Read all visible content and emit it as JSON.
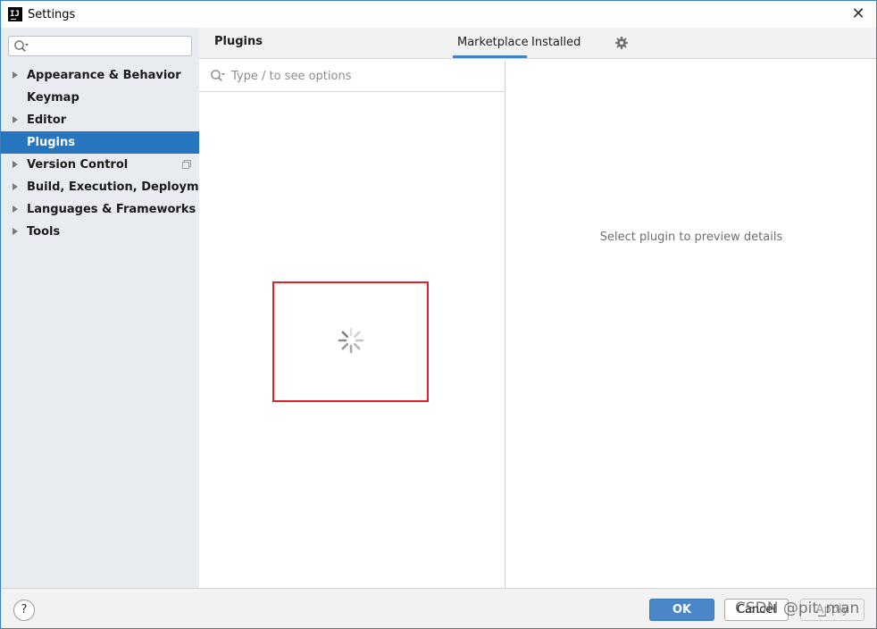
{
  "window": {
    "title": "Settings",
    "close_glyph": "✕",
    "app_icon_text": "IJ"
  },
  "sidebar": {
    "search": {
      "value": "",
      "placeholder": ""
    },
    "items": [
      {
        "label": "Appearance & Behavior",
        "expandable": true,
        "selected": false
      },
      {
        "label": "Keymap",
        "expandable": false,
        "selected": false
      },
      {
        "label": "Editor",
        "expandable": true,
        "selected": false
      },
      {
        "label": "Plugins",
        "expandable": false,
        "selected": true
      },
      {
        "label": "Version Control",
        "expandable": true,
        "selected": false,
        "has_project_icon": true
      },
      {
        "label": "Build, Execution, Deployment",
        "expandable": true,
        "selected": false
      },
      {
        "label": "Languages & Frameworks",
        "expandable": true,
        "selected": false
      },
      {
        "label": "Tools",
        "expandable": true,
        "selected": false
      }
    ]
  },
  "header": {
    "title": "Plugins",
    "tabs": [
      {
        "label": "Marketplace",
        "active": true
      },
      {
        "label": "Installed",
        "active": false
      }
    ]
  },
  "plugin_list": {
    "search": {
      "value": "",
      "placeholder": "Type / to see options"
    },
    "state": "loading"
  },
  "details": {
    "hint": "Select plugin to preview details"
  },
  "footer": {
    "help_label": "?",
    "ok_label": "OK",
    "cancel_label": "Cancel",
    "apply_label": "Apply",
    "watermark": "CSDN @pit_man"
  },
  "colors": {
    "selection": "#2675bf",
    "sidebar_bg": "#e8ecf0",
    "tab_underline": "#4083c9",
    "highlight_border": "#e0202a",
    "ok_button": "#4a86c8"
  },
  "icons": {
    "search": "search-icon",
    "gear": "gear-icon",
    "spinner": "loading-spinner-icon",
    "close": "close-icon",
    "expand": "chevron-right-icon"
  }
}
